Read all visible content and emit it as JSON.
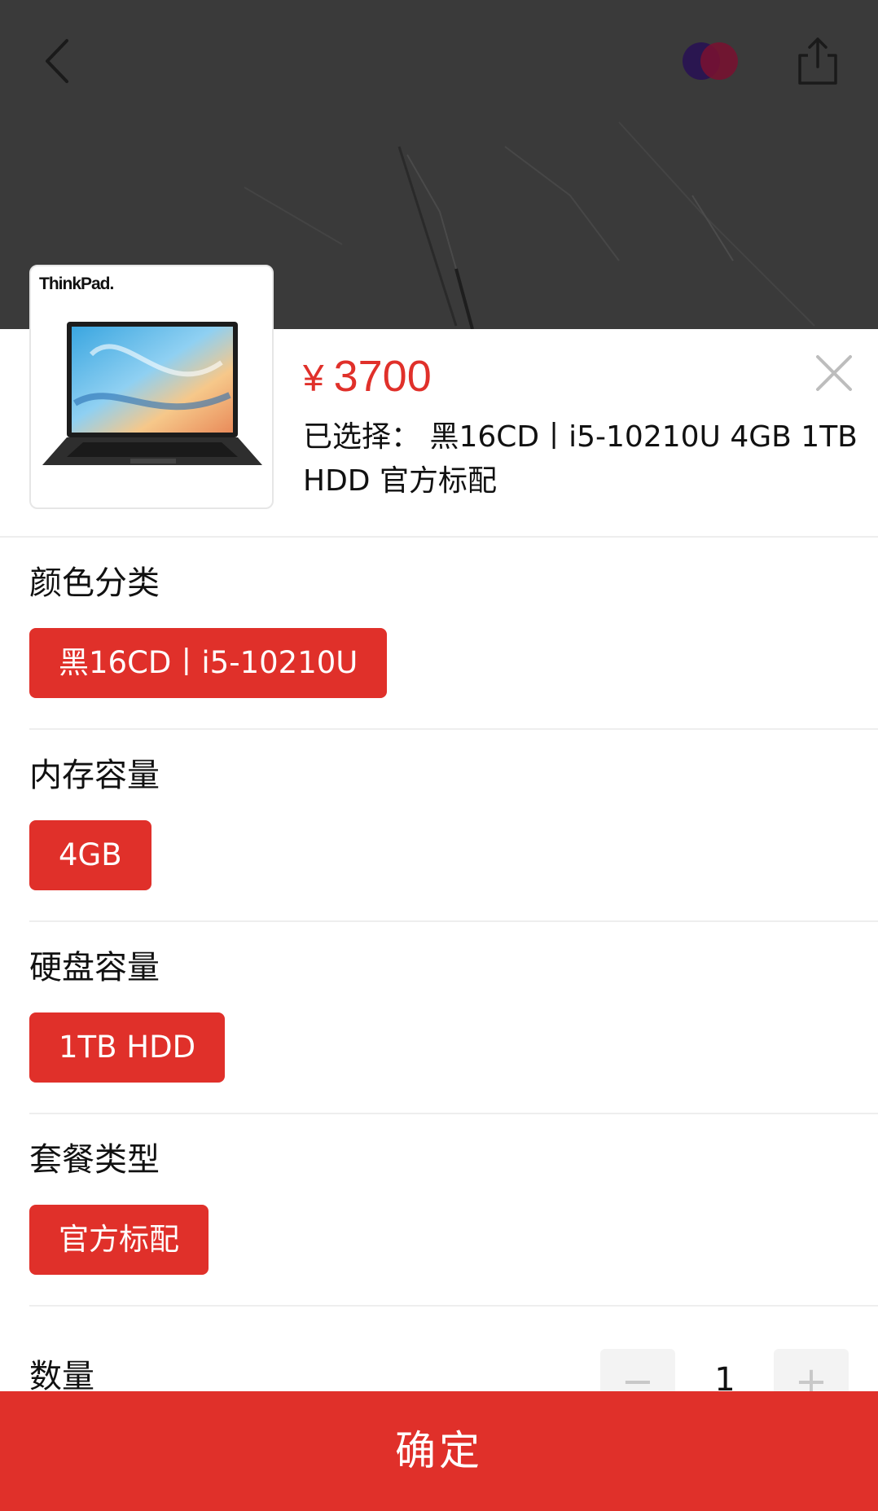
{
  "header": {
    "back_icon": "chevron-left-icon",
    "share_icon": "share-icon",
    "badge_icon": "overlapping-circles-icon"
  },
  "product": {
    "thumbnail_brand": "ThinkPad.",
    "price_symbol": "¥",
    "price": "3700",
    "selected_label": "已选择：",
    "selected_value": "黑16CD丨i5-10210U 4GB 1TB HDD 官方标配"
  },
  "options": [
    {
      "title": "颜色分类",
      "chip": "黑16CD丨i5-10210U"
    },
    {
      "title": "内存容量",
      "chip": "4GB"
    },
    {
      "title": "硬盘容量",
      "chip": "1TB HDD"
    },
    {
      "title": "套餐类型",
      "chip": "官方标配"
    }
  ],
  "quantity": {
    "label": "数量",
    "value": "1",
    "minus": "−",
    "plus": "+"
  },
  "confirm_label": "确定",
  "colors": {
    "accent": "#e0302a",
    "backdrop": "#3a3a3a",
    "divider": "#eeeeee"
  }
}
